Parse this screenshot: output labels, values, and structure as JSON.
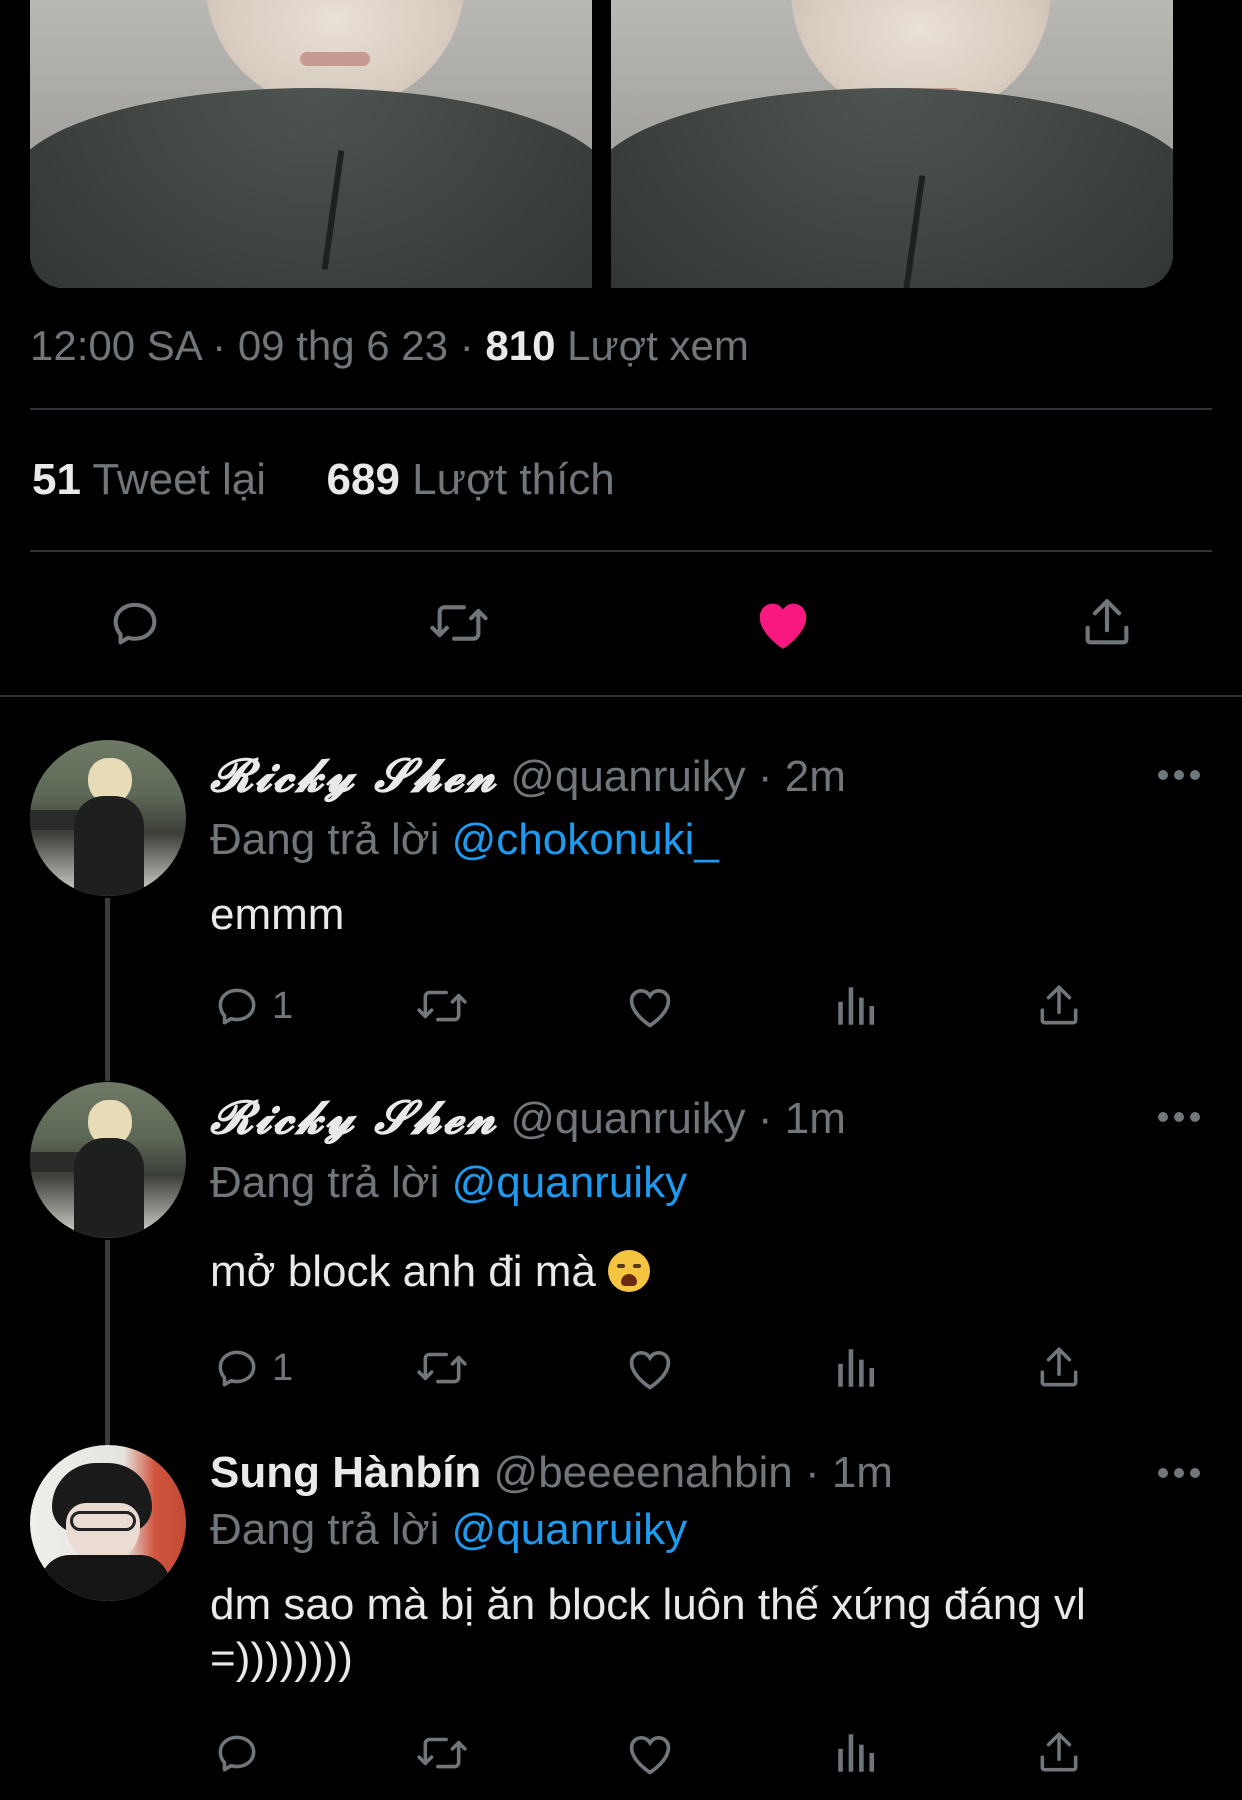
{
  "tweet": {
    "time": "12:00 SA",
    "date": "09 thg 6 23",
    "views_count": "810",
    "views_label": "Lượt xem",
    "retweets_count": "51",
    "retweets_label": "Tweet lại",
    "likes_count": "689",
    "likes_label": "Lượt thích",
    "separator": "·",
    "like_color": "#f91880"
  },
  "replies": [
    {
      "display_name": "𝓡𝓲𝓬𝓴𝔂 𝓢𝓱𝓮𝓷",
      "handle": "@quanruiky",
      "time": "2m",
      "replying_label": "Đang trả lời",
      "replying_to": "@chokonuki_",
      "text": "emmm",
      "reply_count": "1"
    },
    {
      "display_name": "𝓡𝓲𝓬𝓴𝔂 𝓢𝓱𝓮𝓷",
      "handle": "@quanruiky",
      "time": "1m",
      "replying_label": "Đang trả lời",
      "replying_to": "@quanruiky",
      "text": "mở block anh đi mà",
      "reply_count": "1"
    },
    {
      "display_name": "Sung Hànbín",
      "handle": "@beeeenahbin",
      "time": "1m",
      "replying_label": "Đang trả lời",
      "replying_to": "@quanruiky",
      "text": "dm sao mà bị ăn block luôn thế xứng đáng vl =))))))))",
      "reply_count": ""
    }
  ],
  "colors": {
    "background": "#000000",
    "muted": "#71767b",
    "mention": "#1d9bf0",
    "like": "#f91880"
  },
  "icons": [
    "reply-icon",
    "retweet-icon",
    "like-icon",
    "share-icon",
    "views-icon",
    "more-icon"
  ]
}
